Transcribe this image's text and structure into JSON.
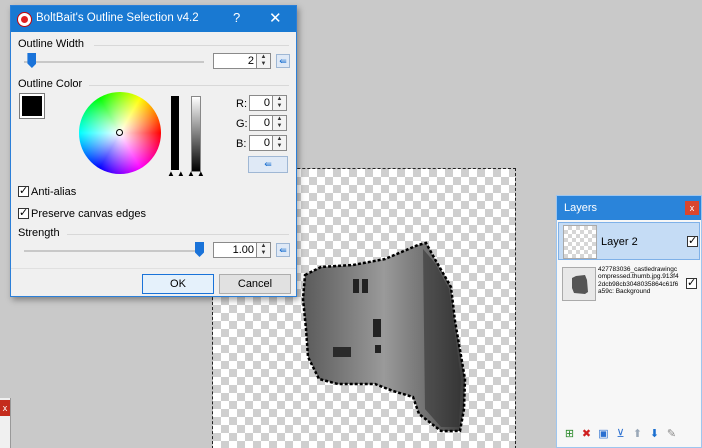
{
  "dialog": {
    "title": "BoltBait's Outline Selection v4.2",
    "help_label": "?",
    "close_label": "✕",
    "outline_width_label": "Outline Width",
    "outline_width_value": "2",
    "outline_width_fraction": 0.02,
    "outline_color_label": "Outline Color",
    "r_label": "R:",
    "g_label": "G:",
    "b_label": "B:",
    "r_value": "0",
    "g_value": "0",
    "b_value": "0",
    "antialias_label": "Anti-alias",
    "preserve_label": "Preserve canvas edges",
    "strength_label": "Strength",
    "strength_value": "1.00",
    "strength_fraction": 1.0,
    "ok_label": "OK",
    "cancel_label": "Cancel",
    "reset_icon": "⇚",
    "selected_color": "#000000"
  },
  "layers": {
    "title": "Layers",
    "close_label": "x",
    "items": [
      {
        "name": "Layer 2",
        "checked": true,
        "selected": true
      },
      {
        "name": "427783036_castledrawingcompressed.thumb.jpg.913f42dcb98cb3048035864c61f6a59c: Background",
        "checked": true,
        "selected": false
      }
    ],
    "tools": [
      "add-layer-icon",
      "delete-layer-icon",
      "duplicate-layer-icon",
      "merge-layer-icon",
      "move-up-icon",
      "move-down-icon",
      "properties-icon"
    ]
  },
  "colors": {
    "accent": "#1979d2",
    "canvas_bg": "#c9c9c9"
  }
}
